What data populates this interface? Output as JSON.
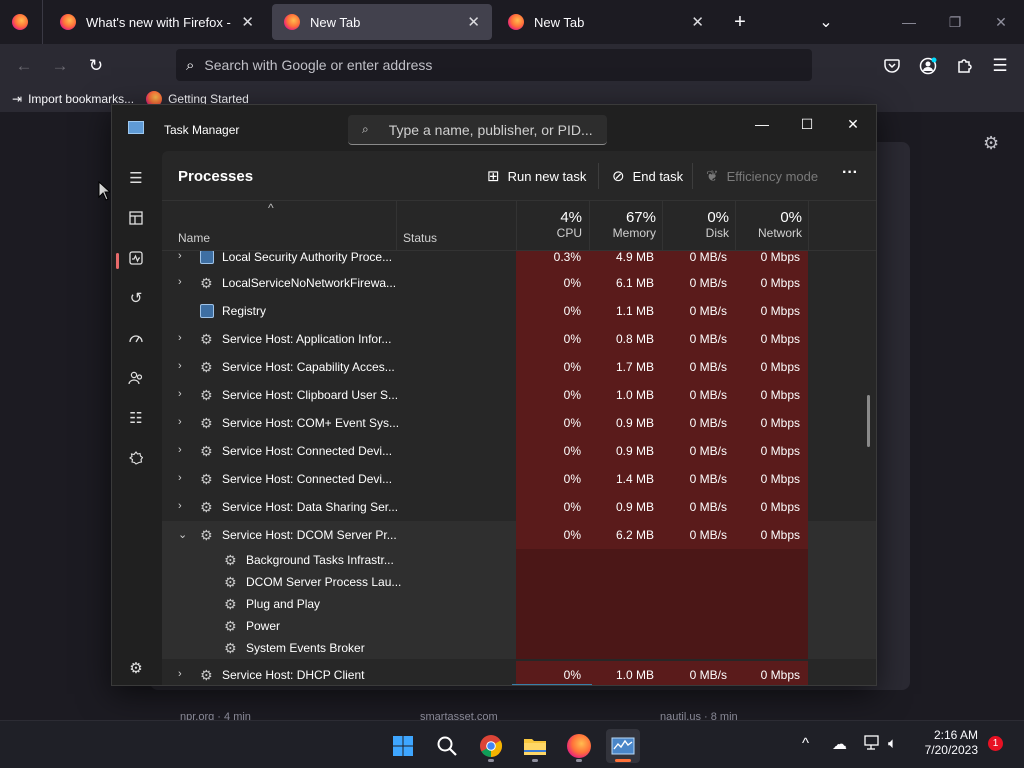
{
  "browser": {
    "tabs": [
      {
        "title": "What's new with Firefox - More",
        "close": "✕"
      },
      {
        "title": "New Tab",
        "close": "✕"
      },
      {
        "title": "New Tab",
        "close": "✕"
      }
    ],
    "new_tab": "+",
    "list_tabs": "⌄",
    "window_controls": {
      "minimize": "—",
      "restore": "❐",
      "close": "✕"
    },
    "nav": {
      "back": "←",
      "forward": "→",
      "reload": "↻"
    },
    "urlbar_placeholder": "Search with Google or enter address",
    "bookmarks": [
      {
        "label": "Import bookmarks..."
      },
      {
        "label": "Getting Started"
      }
    ],
    "newtab_snippets": [
      "npr.org · 4 min",
      "smartasset.com",
      "nautil.us · 8 min"
    ]
  },
  "taskmanager": {
    "title": "Task Manager",
    "search_placeholder": "Type a name, publisher, or PID...",
    "window_controls": {
      "minimize": "—",
      "maximize": "☐",
      "close": "✕"
    },
    "page_heading": "Processes",
    "actions": {
      "run_new_task": "Run new task",
      "end_task": "End task",
      "efficiency_mode": "Efficiency mode",
      "more": "···"
    },
    "columns": {
      "name": "Name",
      "status": "Status",
      "cpu": {
        "pct": "4%",
        "label": "CPU"
      },
      "memory": {
        "pct": "67%",
        "label": "Memory"
      },
      "disk": {
        "pct": "0%",
        "label": "Disk"
      },
      "network": {
        "pct": "0%",
        "label": "Network"
      }
    },
    "sort_indicator": "^",
    "processes": [
      {
        "name": "Local Security Authority Proce...",
        "cpu": "0.3%",
        "memory": "4.9 MB",
        "disk": "0 MB/s",
        "network": "0 Mbps",
        "expand": "›",
        "icon": "app"
      },
      {
        "name": "LocalServiceNoNetworkFirewa...",
        "cpu": "0%",
        "memory": "6.1 MB",
        "disk": "0 MB/s",
        "network": "0 Mbps",
        "expand": "›",
        "icon": "service"
      },
      {
        "name": "Registry",
        "cpu": "0%",
        "memory": "1.1 MB",
        "disk": "0 MB/s",
        "network": "0 Mbps",
        "expand": "",
        "icon": "app"
      },
      {
        "name": "Service Host: Application Infor...",
        "cpu": "0%",
        "memory": "0.8 MB",
        "disk": "0 MB/s",
        "network": "0 Mbps",
        "expand": "›",
        "icon": "service"
      },
      {
        "name": "Service Host: Capability Acces...",
        "cpu": "0%",
        "memory": "1.7 MB",
        "disk": "0 MB/s",
        "network": "0 Mbps",
        "expand": "›",
        "icon": "service"
      },
      {
        "name": "Service Host: Clipboard User S...",
        "cpu": "0%",
        "memory": "1.0 MB",
        "disk": "0 MB/s",
        "network": "0 Mbps",
        "expand": "›",
        "icon": "service"
      },
      {
        "name": "Service Host: COM+ Event Sys...",
        "cpu": "0%",
        "memory": "0.9 MB",
        "disk": "0 MB/s",
        "network": "0 Mbps",
        "expand": "›",
        "icon": "service"
      },
      {
        "name": "Service Host: Connected Devi...",
        "cpu": "0%",
        "memory": "0.9 MB",
        "disk": "0 MB/s",
        "network": "0 Mbps",
        "expand": "›",
        "icon": "service"
      },
      {
        "name": "Service Host: Connected Devi...",
        "cpu": "0%",
        "memory": "1.4 MB",
        "disk": "0 MB/s",
        "network": "0 Mbps",
        "expand": "›",
        "icon": "service"
      },
      {
        "name": "Service Host: Data Sharing Ser...",
        "cpu": "0%",
        "memory": "0.9 MB",
        "disk": "0 MB/s",
        "network": "0 Mbps",
        "expand": "›",
        "icon": "service"
      },
      {
        "name": "Service Host: DCOM Server Pr...",
        "cpu": "0%",
        "memory": "6.2 MB",
        "disk": "0 MB/s",
        "network": "0 Mbps",
        "expand": "⌄",
        "icon": "service",
        "expanded": true
      }
    ],
    "children": [
      {
        "name": "Background Tasks Infrastr..."
      },
      {
        "name": "DCOM Server Process Lau..."
      },
      {
        "name": "Plug and Play"
      },
      {
        "name": "Power"
      },
      {
        "name": "System Events Broker"
      }
    ],
    "last_process": {
      "name": "Service Host: DHCP Client",
      "cpu": "0%",
      "memory": "1.0 MB",
      "disk": "0 MB/s",
      "network": "0 Mbps",
      "expand": "›"
    }
  },
  "taskbar": {
    "time": "2:16 AM",
    "date": "7/20/2023",
    "notifications": "1",
    "tray_chevron": "^"
  },
  "colors": {
    "heat": "#5a1b1b",
    "accent_firefox": "#ff7139",
    "rail_selection": "#e86a6a"
  }
}
